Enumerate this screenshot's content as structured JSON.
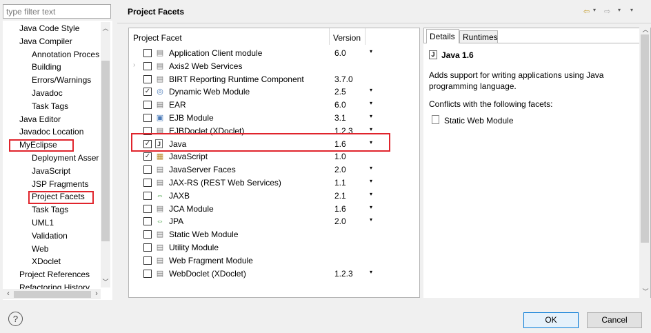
{
  "filter": {
    "placeholder": "type filter text"
  },
  "tree": [
    {
      "label": "Java Code Style",
      "indent": 1
    },
    {
      "label": "Java Compiler",
      "indent": 1
    },
    {
      "label": "Annotation Proces",
      "indent": 2
    },
    {
      "label": "Building",
      "indent": 2
    },
    {
      "label": "Errors/Warnings",
      "indent": 2
    },
    {
      "label": "Javadoc",
      "indent": 2
    },
    {
      "label": "Task Tags",
      "indent": 2
    },
    {
      "label": "Java Editor",
      "indent": 1
    },
    {
      "label": "Javadoc Location",
      "indent": 1
    },
    {
      "label": "MyEclipse",
      "indent": 1
    },
    {
      "label": "Deployment Asser",
      "indent": 2
    },
    {
      "label": "JavaScript",
      "indent": 2
    },
    {
      "label": "JSP Fragments",
      "indent": 2
    },
    {
      "label": "Project Facets",
      "indent": 2
    },
    {
      "label": "Task Tags",
      "indent": 2
    },
    {
      "label": "UML1",
      "indent": 2
    },
    {
      "label": "Validation",
      "indent": 2
    },
    {
      "label": "Web",
      "indent": 2
    },
    {
      "label": "XDoclet",
      "indent": 2
    },
    {
      "label": "Project References",
      "indent": 1
    },
    {
      "label": "Refactoring History",
      "indent": 1
    }
  ],
  "header": {
    "title": "Project Facets"
  },
  "table": {
    "col_facet": "Project Facet",
    "col_version": "Version",
    "rows": [
      {
        "name": "Application Client module",
        "version": "6.0",
        "checked": false,
        "dropdown": true,
        "icon": "doc"
      },
      {
        "name": "Axis2 Web Services",
        "version": "",
        "checked": false,
        "dropdown": false,
        "icon": "doc",
        "expander": true
      },
      {
        "name": "BIRT Reporting Runtime Component",
        "version": "3.7.0",
        "checked": false,
        "dropdown": false,
        "icon": "doc"
      },
      {
        "name": "Dynamic Web Module",
        "version": "2.5",
        "checked": true,
        "dropdown": true,
        "icon": "globe"
      },
      {
        "name": "EAR",
        "version": "6.0",
        "checked": false,
        "dropdown": true,
        "icon": "doc"
      },
      {
        "name": "EJB Module",
        "version": "3.1",
        "checked": false,
        "dropdown": true,
        "icon": "ejb"
      },
      {
        "name": "EJBDoclet (XDoclet)",
        "version": "1.2.3",
        "checked": false,
        "dropdown": true,
        "icon": "doc"
      },
      {
        "name": "Java",
        "version": "1.6",
        "checked": true,
        "dropdown": true,
        "icon": "java"
      },
      {
        "name": "JavaScript",
        "version": "1.0",
        "checked": true,
        "dropdown": false,
        "icon": "js"
      },
      {
        "name": "JavaServer Faces",
        "version": "2.0",
        "checked": false,
        "dropdown": true,
        "icon": "doc"
      },
      {
        "name": "JAX-RS (REST Web Services)",
        "version": "1.1",
        "checked": false,
        "dropdown": true,
        "icon": "doc"
      },
      {
        "name": "JAXB",
        "version": "2.1",
        "checked": false,
        "dropdown": true,
        "icon": "arrows"
      },
      {
        "name": "JCA Module",
        "version": "1.6",
        "checked": false,
        "dropdown": true,
        "icon": "doc"
      },
      {
        "name": "JPA",
        "version": "2.0",
        "checked": false,
        "dropdown": true,
        "icon": "arrows"
      },
      {
        "name": "Static Web Module",
        "version": "",
        "checked": false,
        "dropdown": false,
        "icon": "doc"
      },
      {
        "name": "Utility Module",
        "version": "",
        "checked": false,
        "dropdown": false,
        "icon": "doc"
      },
      {
        "name": "Web Fragment Module",
        "version": "",
        "checked": false,
        "dropdown": false,
        "icon": "doc"
      },
      {
        "name": "WebDoclet (XDoclet)",
        "version": "1.2.3",
        "checked": false,
        "dropdown": true,
        "icon": "doc"
      }
    ]
  },
  "details": {
    "tab_details": "Details",
    "tab_runtimes": "Runtimes",
    "heading": "Java 1.6",
    "description": "Adds support for writing applications using Java programming language.",
    "conflicts_label": "Conflicts with the following facets:",
    "conflict_item": "Static Web Module"
  },
  "buttons": {
    "ok": "OK",
    "cancel": "Cancel"
  },
  "icons": {
    "help": "?",
    "checked": "✓",
    "dropdown": "▾"
  },
  "colors": {
    "highlight": "#e0242c",
    "ok_border": "#0078d7"
  }
}
